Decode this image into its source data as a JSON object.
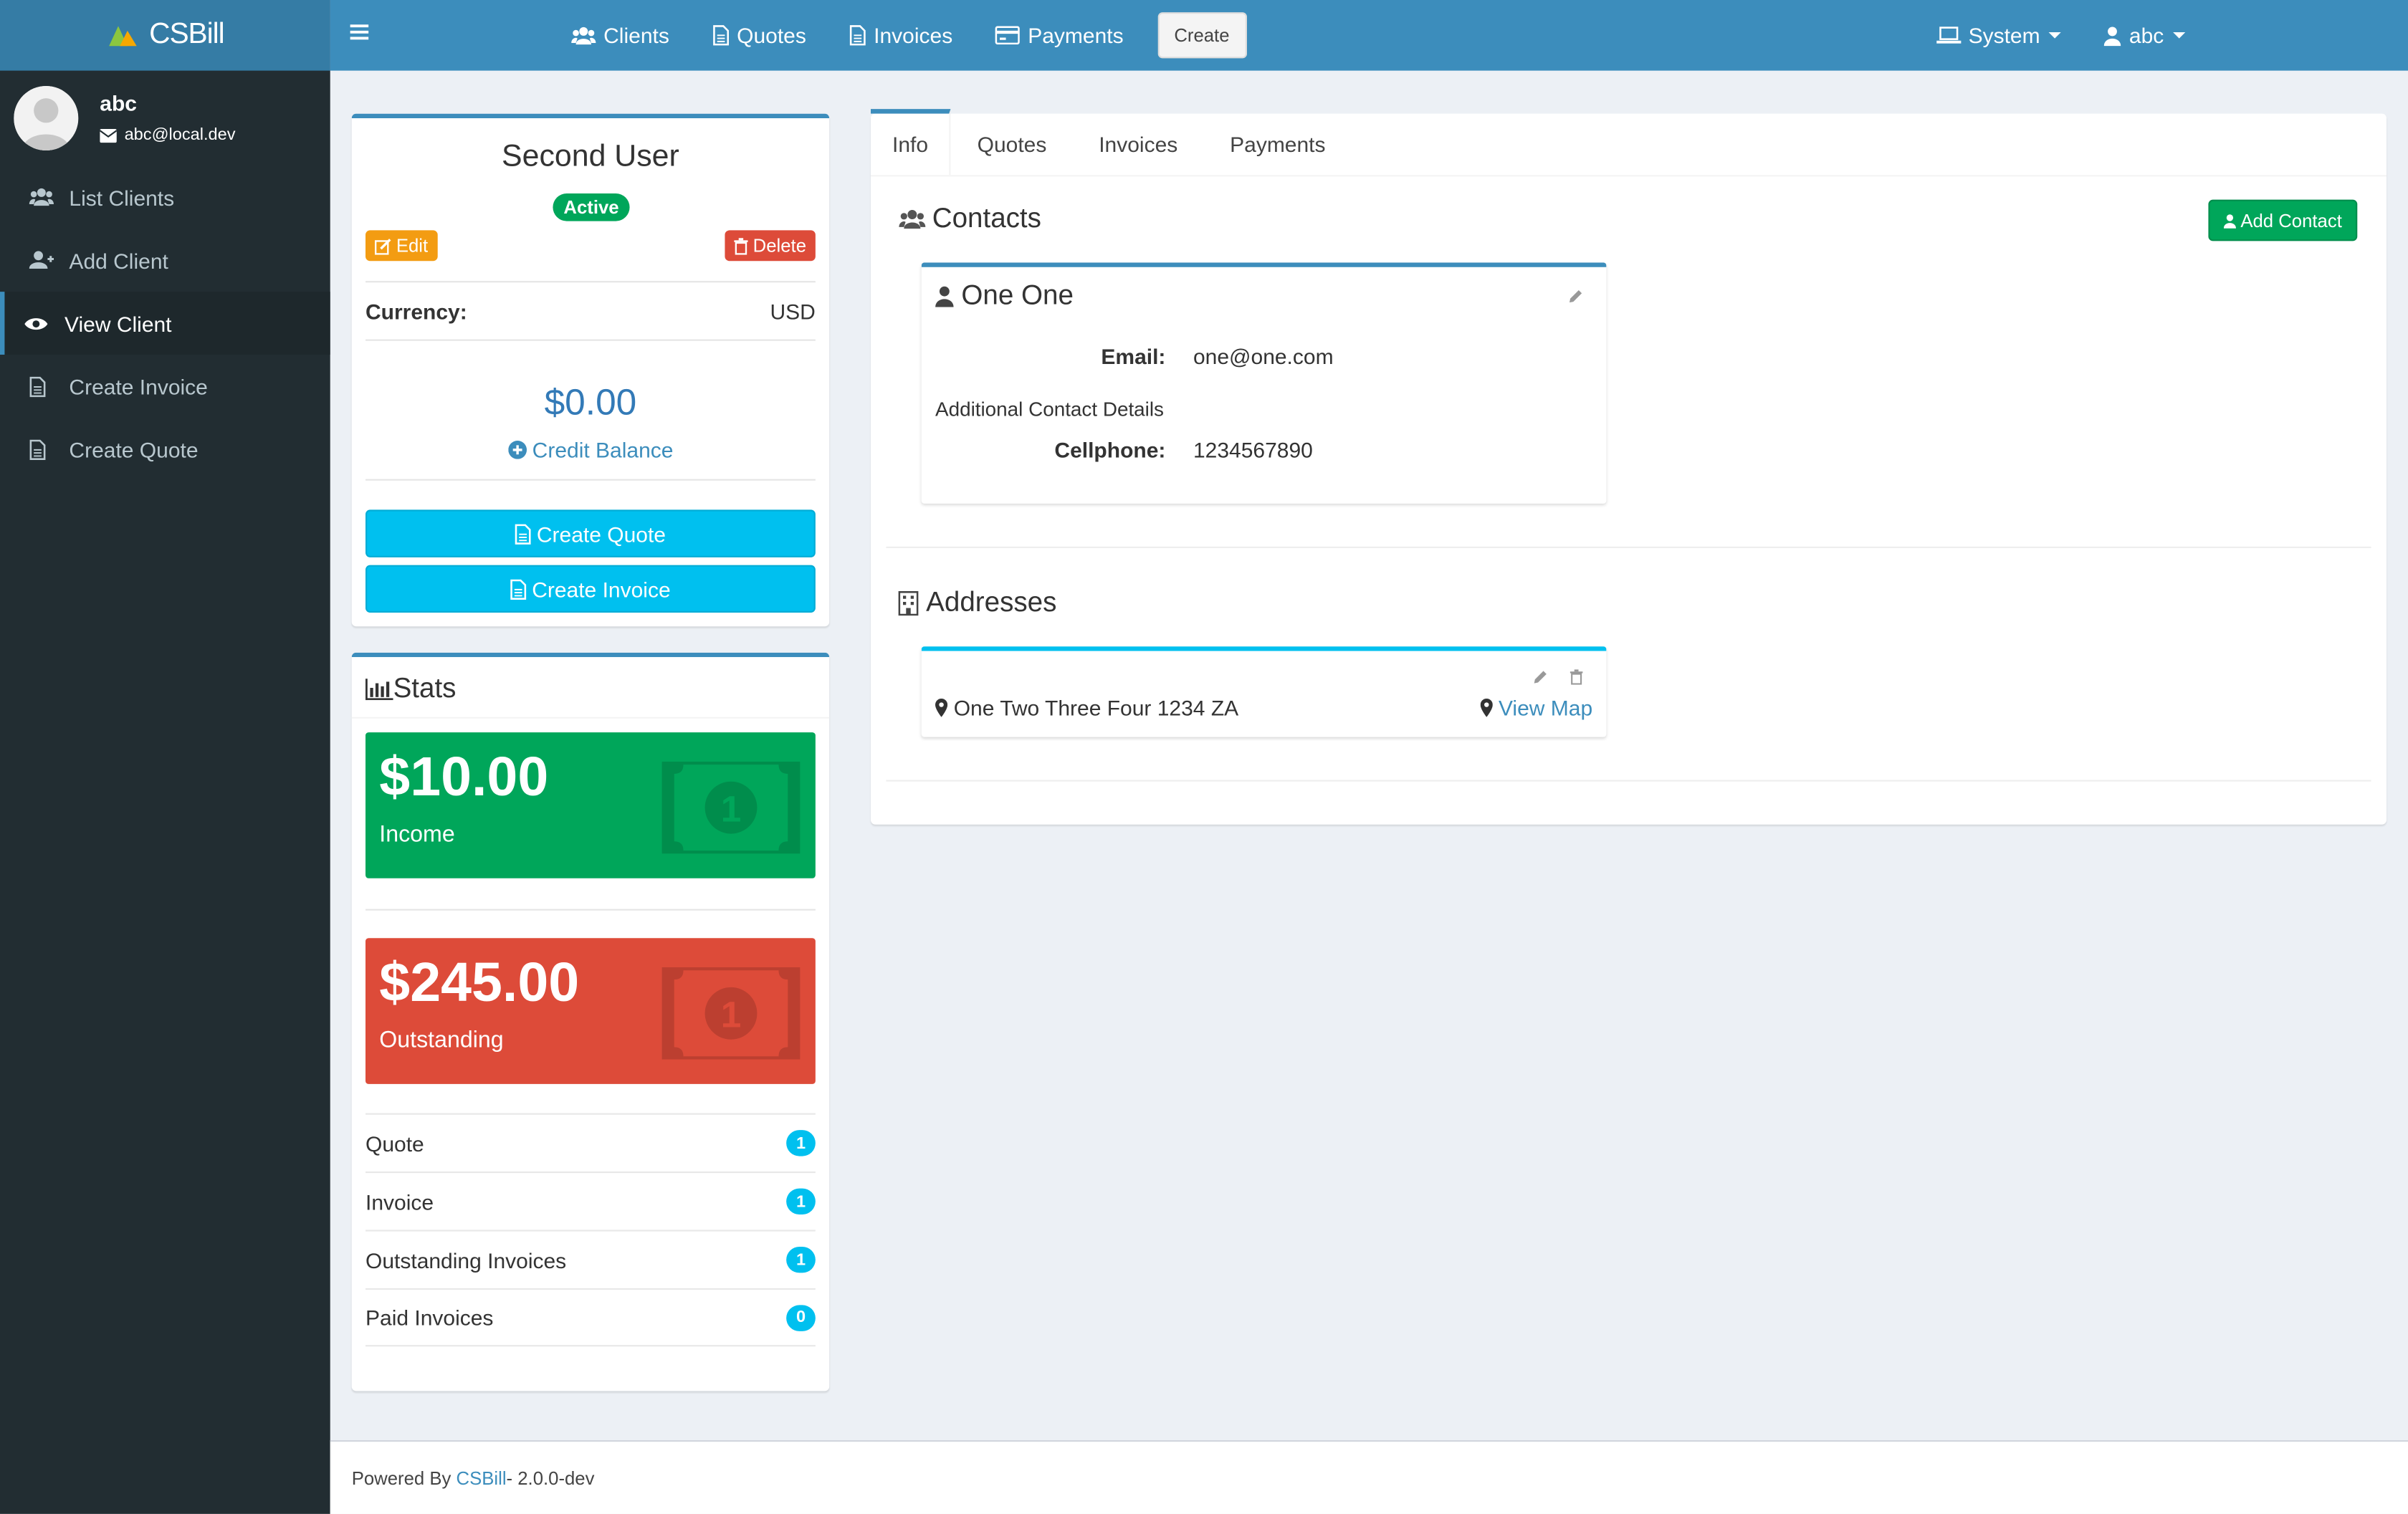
{
  "app": {
    "title": "CSBill"
  },
  "user": {
    "name": "abc",
    "email": "abc@local.dev"
  },
  "sidebar": {
    "items": [
      {
        "label": "List Clients",
        "icon": "users-icon"
      },
      {
        "label": "Add Client",
        "icon": "user-plus-icon"
      },
      {
        "label": "View Client",
        "icon": "eye-icon",
        "active": true
      },
      {
        "label": "Create Invoice",
        "icon": "file-icon"
      },
      {
        "label": "Create Quote",
        "icon": "file-icon"
      }
    ]
  },
  "topnav": {
    "items": [
      {
        "label": "Clients",
        "icon": "users-icon"
      },
      {
        "label": "Quotes",
        "icon": "file-icon"
      },
      {
        "label": "Invoices",
        "icon": "file-icon"
      },
      {
        "label": "Payments",
        "icon": "credit-card-icon"
      }
    ],
    "create_label": "Create",
    "system_label": "System",
    "user_label": "abc"
  },
  "client": {
    "name": "Second User",
    "status": "Active",
    "edit_label": "Edit",
    "delete_label": "Delete",
    "currency_label": "Currency:",
    "currency_value": "USD",
    "credit_amount": "$0.00",
    "credit_label": "Credit Balance",
    "create_quote_label": "Create Quote",
    "create_invoice_label": "Create Invoice"
  },
  "stats": {
    "title": "Stats",
    "income": {
      "amount": "$10.00",
      "label": "Income",
      "color": "#00a65a"
    },
    "outstanding": {
      "amount": "$245.00",
      "label": "Outstanding",
      "color": "#dd4b39"
    },
    "rows": [
      {
        "label": "Quote",
        "count": "1"
      },
      {
        "label": "Invoice",
        "count": "1"
      },
      {
        "label": "Outstanding Invoices",
        "count": "1"
      },
      {
        "label": "Paid Invoices",
        "count": "0"
      }
    ]
  },
  "tabs": [
    {
      "label": "Info",
      "active": true
    },
    {
      "label": "Quotes"
    },
    {
      "label": "Invoices"
    },
    {
      "label": "Payments"
    }
  ],
  "contacts": {
    "title": "Contacts",
    "add_label": "Add Contact",
    "card": {
      "name": "One One",
      "email_label": "Email:",
      "email_value": "one@one.com",
      "additional_label": "Additional Contact Details",
      "cellphone_label": "Cellphone:",
      "cellphone_value": "1234567890"
    }
  },
  "addresses": {
    "title": "Addresses",
    "card": {
      "address": "One Two Three Four 1234 ZA",
      "map_label": "View Map"
    }
  },
  "footer": {
    "prefix": "Powered By ",
    "link": "CSBill",
    "suffix": " - 2.0.0-dev"
  },
  "colors": {
    "primary": "#3c8dbc",
    "sidebar": "#222d32",
    "success": "#00a65a",
    "danger": "#dd4b39",
    "info": "#00c0ef",
    "warning": "#f39c12"
  }
}
